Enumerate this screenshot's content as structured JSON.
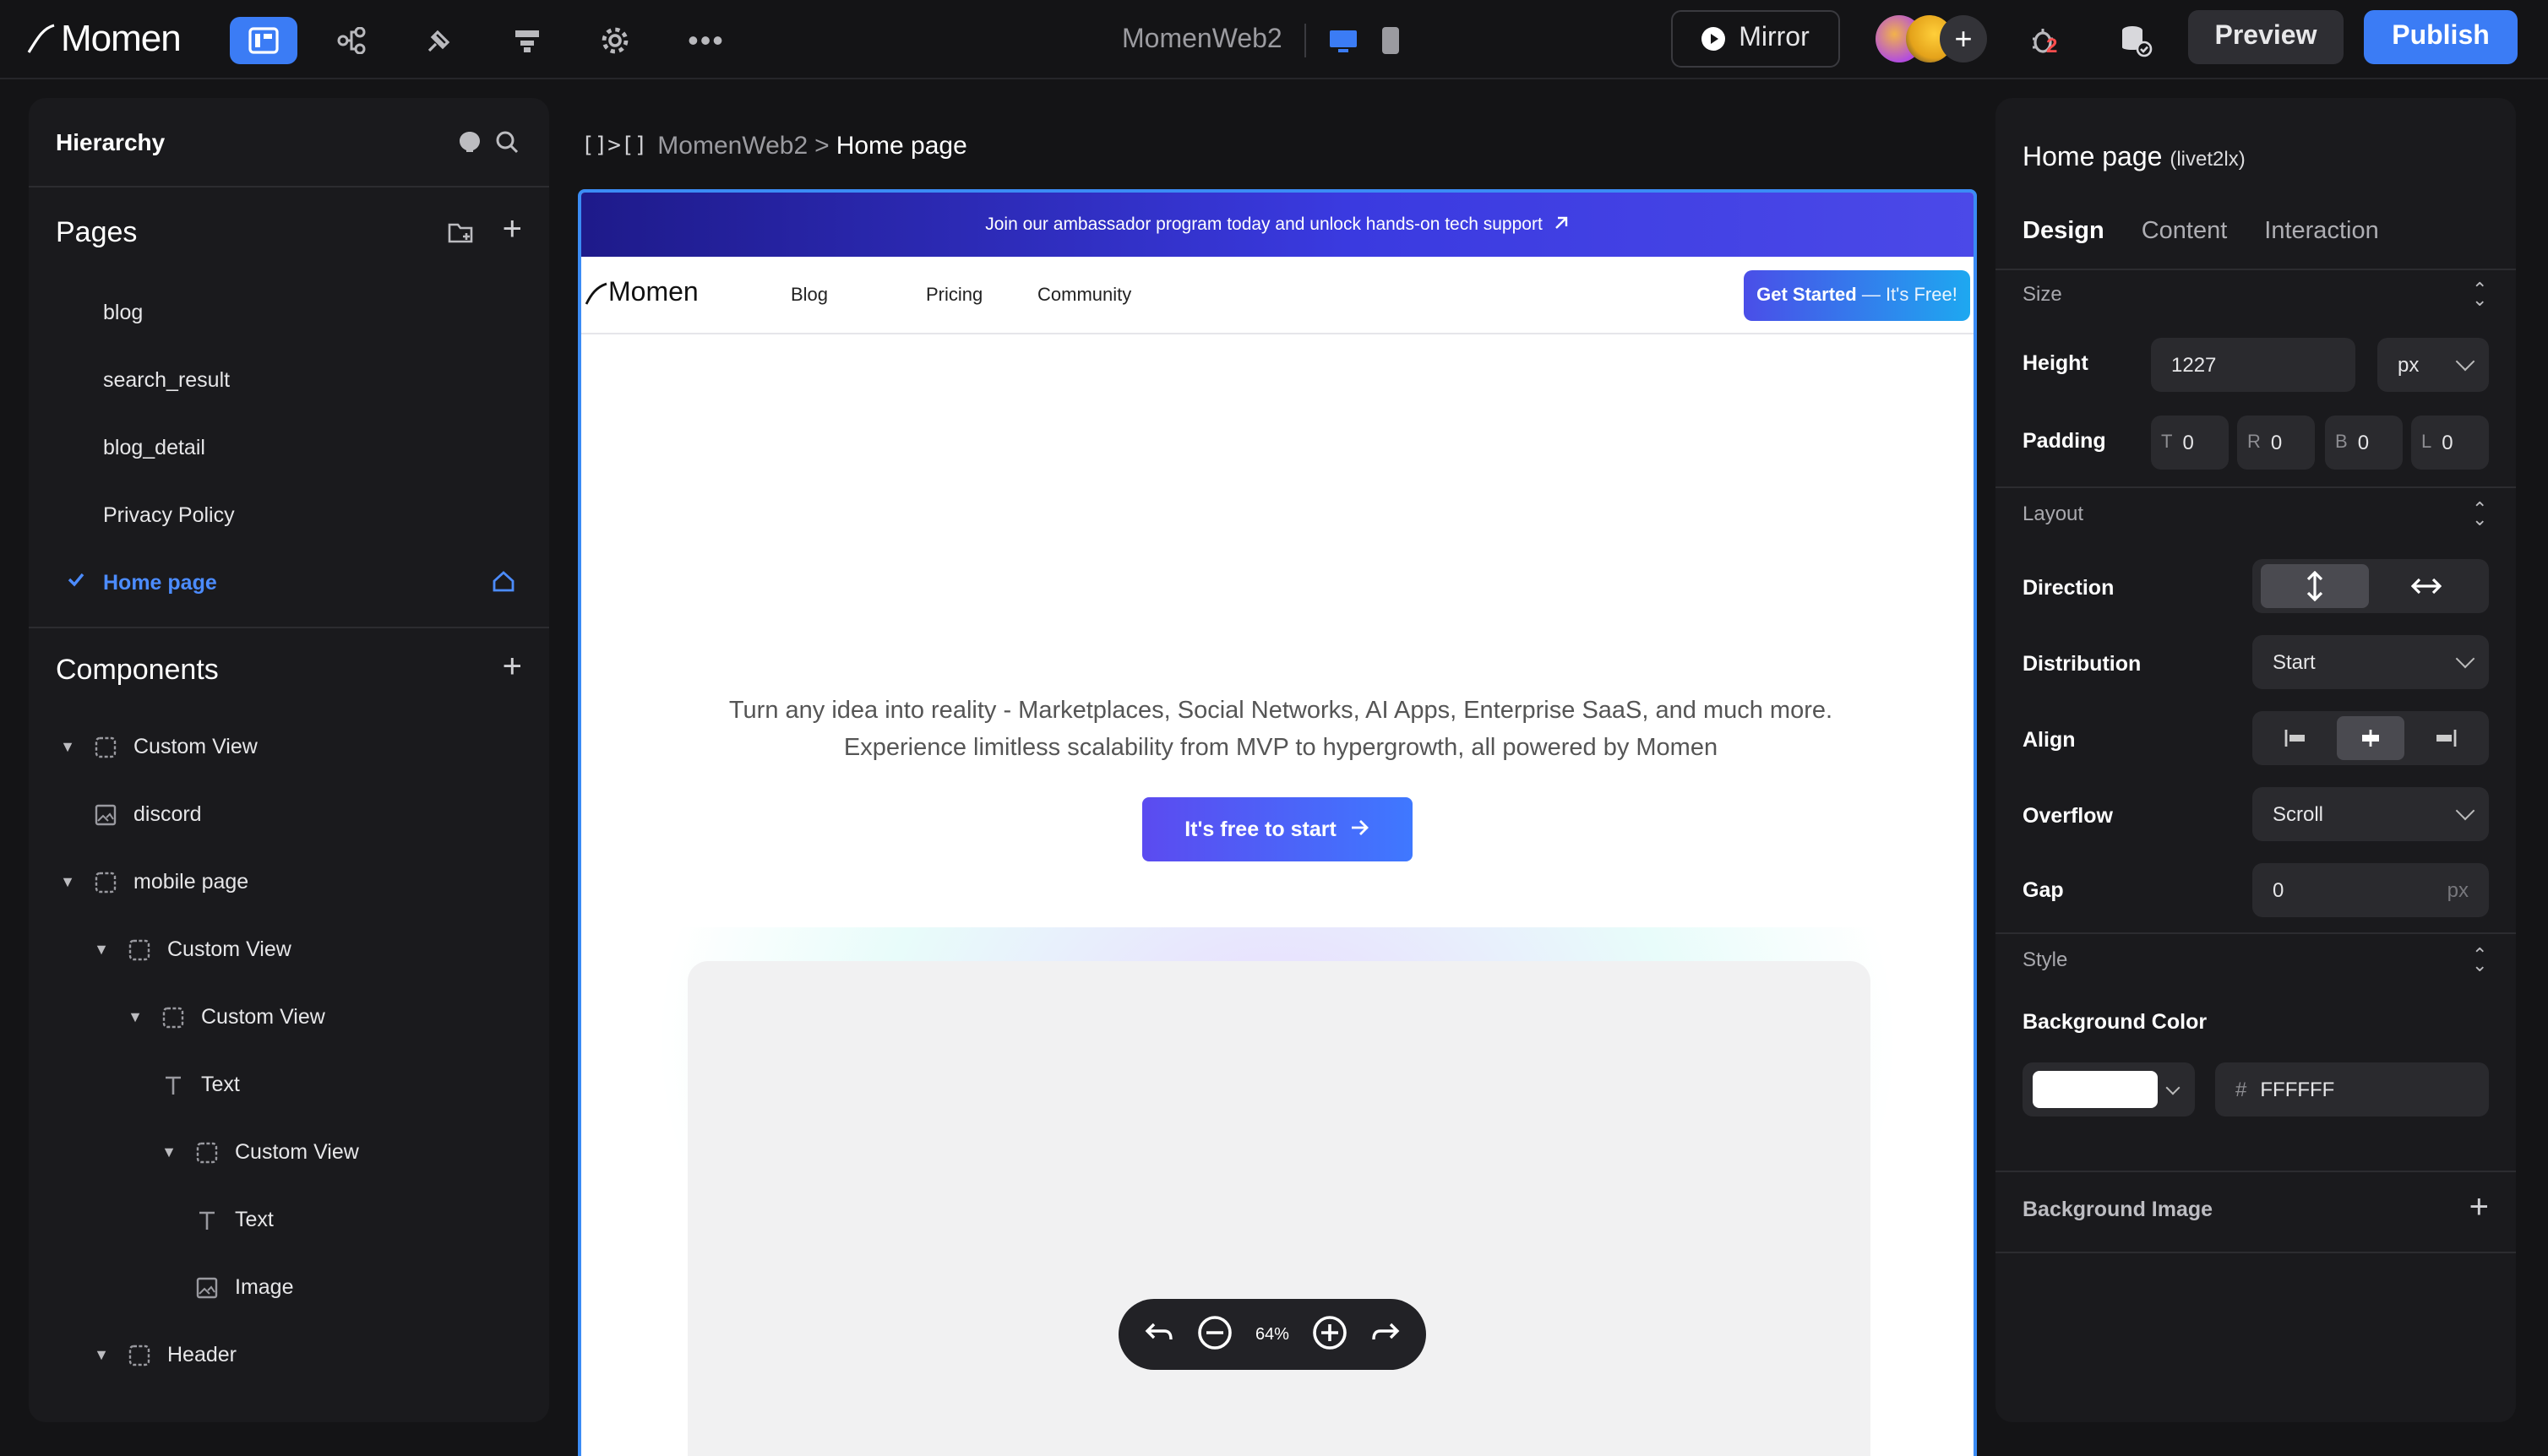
{
  "app": {
    "brand": "Momen",
    "project_title": "MomenWeb2"
  },
  "toolbar": {
    "mirror_label": "Mirror",
    "preview_label": "Preview",
    "publish_label": "Publish",
    "debug_count": "2"
  },
  "hierarchy": {
    "title": "Hierarchy",
    "pages_title": "Pages",
    "pages": [
      "blog",
      "search_result",
      "blog_detail",
      "Privacy Policy",
      "Home page"
    ],
    "components_title": "Components",
    "components": [
      {
        "label": "Custom View",
        "indent": 0,
        "caret": true,
        "icon": "view-icon"
      },
      {
        "label": "discord",
        "indent": 0,
        "caret": false,
        "icon": "image-icon"
      },
      {
        "label": "mobile page",
        "indent": 0,
        "caret": true,
        "icon": "view-icon"
      },
      {
        "label": "Custom View",
        "indent": 1,
        "caret": true,
        "icon": "view-icon"
      },
      {
        "label": "Custom View",
        "indent": 2,
        "caret": true,
        "icon": "view-icon"
      },
      {
        "label": "Text",
        "indent": 2,
        "caret": false,
        "icon": "text-icon"
      },
      {
        "label": "Custom View",
        "indent": 3,
        "caret": true,
        "icon": "view-icon"
      },
      {
        "label": "Text",
        "indent": 3,
        "caret": false,
        "icon": "text-icon"
      },
      {
        "label": "Image",
        "indent": 3,
        "caret": false,
        "icon": "image-icon"
      },
      {
        "label": "Header",
        "indent": 1,
        "caret": true,
        "icon": "view-icon"
      }
    ]
  },
  "breadcrumb": {
    "project": "MomenWeb2",
    "separator": ">",
    "page": "Home page"
  },
  "preview_page": {
    "banner": "Join our ambassador program today and unlock hands-on tech support",
    "nav_logo": "Momen",
    "nav_links": [
      "Blog",
      "Pricing",
      "Community"
    ],
    "cta_top_bold": "Get Started",
    "cta_top_rest": " — It's Free!",
    "hero_line1": "Turn any idea into reality - Marketplaces, Social Networks, AI Apps, Enterprise SaaS, and much more.",
    "hero_line2": "Experience limitless scalability from MVP to hypergrowth, all powered by Momen",
    "cta_main": "It's free to start"
  },
  "zoom": {
    "level": "64%"
  },
  "inspector": {
    "title": "Home page",
    "id": "(livet2lx)",
    "tabs": [
      "Design",
      "Content",
      "Interaction"
    ],
    "size_section": "Size",
    "height_label": "Height",
    "height_value": "1227",
    "height_unit": "px",
    "padding_label": "Padding",
    "padding": [
      {
        "k": "T",
        "v": "0"
      },
      {
        "k": "R",
        "v": "0"
      },
      {
        "k": "B",
        "v": "0"
      },
      {
        "k": "L",
        "v": "0"
      }
    ],
    "layout_section": "Layout",
    "direction_label": "Direction",
    "distribution_label": "Distribution",
    "distribution_value": "Start",
    "align_label": "Align",
    "overflow_label": "Overflow",
    "overflow_value": "Scroll",
    "gap_label": "Gap",
    "gap_value": "0",
    "gap_unit": "px",
    "style_section": "Style",
    "bg_color_label": "Background Color",
    "bg_hash": "#",
    "bg_color_value": "FFFFFF",
    "bg_image_label": "Background Image"
  },
  "colors": {
    "accent": "#3b7cf5",
    "active_page": "#4c8cff",
    "canvas_border": "#3b8cf5"
  }
}
